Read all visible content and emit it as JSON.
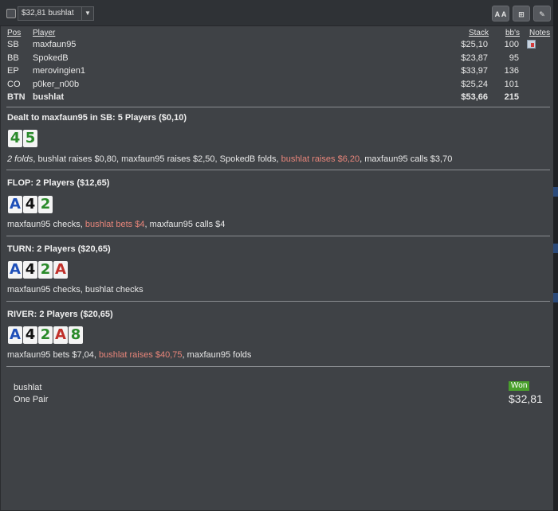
{
  "toolbar": {
    "selected_hand": "$32,81 bushlat",
    "font_button": "A A",
    "grid_button": "⊞",
    "edit_button": "✎"
  },
  "players_header": {
    "pos": "Pos",
    "player": "Player",
    "stack": "Stack",
    "bbs": "bb's",
    "notes": "Notes"
  },
  "players": [
    {
      "pos": "SB",
      "name": "maxfaun95",
      "stack": "$25,10",
      "bbs": "100",
      "note": true
    },
    {
      "pos": "BB",
      "name": "SpokedB",
      "stack": "$23,87",
      "bbs": "95"
    },
    {
      "pos": "EP",
      "name": "merovingien1",
      "stack": "$33,97",
      "bbs": "136"
    },
    {
      "pos": "CO",
      "name": "p0ker_n00b",
      "stack": "$25,24",
      "bbs": "101"
    },
    {
      "pos": "BTN",
      "name": "bushlat",
      "stack": "$53,66",
      "bbs": "215",
      "bold": true
    }
  ],
  "preflop": {
    "title": "Dealt to maxfaun95 in SB: 5 Players ($0,10)",
    "cards": [
      {
        "rank": "4",
        "suit": "c"
      },
      {
        "rank": "5",
        "suit": "c"
      }
    ],
    "actions": [
      {
        "text": "2 folds",
        "style": "ital"
      },
      {
        "text": ", bushlat raises $0,80, maxfaun95 raises $2,50, SpokedB folds, "
      },
      {
        "text": "bushlat raises $6,20",
        "style": "hero"
      },
      {
        "text": ", maxfaun95 calls $3,70"
      }
    ]
  },
  "flop": {
    "title": "FLOP: 2 Players ($12,65)",
    "cards": [
      {
        "rank": "A",
        "suit": "d"
      },
      {
        "rank": "4",
        "suit": "s"
      },
      {
        "rank": "2",
        "suit": "c"
      }
    ],
    "actions": [
      {
        "text": "maxfaun95 checks, "
      },
      {
        "text": "bushlat bets $4",
        "style": "hero"
      },
      {
        "text": ", maxfaun95 calls $4"
      }
    ]
  },
  "turn": {
    "title": "TURN: 2 Players ($20,65)",
    "cards": [
      {
        "rank": "A",
        "suit": "d"
      },
      {
        "rank": "4",
        "suit": "s"
      },
      {
        "rank": "2",
        "suit": "c"
      },
      {
        "rank": "A",
        "suit": "h"
      }
    ],
    "actions": [
      {
        "text": "maxfaun95 checks, bushlat checks"
      }
    ]
  },
  "river": {
    "title": "RIVER: 2 Players ($20,65)",
    "cards": [
      {
        "rank": "A",
        "suit": "d"
      },
      {
        "rank": "4",
        "suit": "s"
      },
      {
        "rank": "2",
        "suit": "c"
      },
      {
        "rank": "A",
        "suit": "h"
      },
      {
        "rank": "8",
        "suit": "c"
      }
    ],
    "actions": [
      {
        "text": "maxfaun95 bets $7,04, "
      },
      {
        "text": "bushlat raises $40,75",
        "style": "hero"
      },
      {
        "text": ", maxfaun95 folds"
      }
    ]
  },
  "result": {
    "winner": "bushlat",
    "hand": "One Pair",
    "badge": "Won",
    "amount": "$32,81"
  },
  "colors": {
    "hero_action": "#e8857a",
    "won_badge": "#4aa02c",
    "clubs": "#2a8a2a",
    "diamonds": "#1e4fb8",
    "hearts": "#c0302a",
    "spades": "#111111"
  }
}
